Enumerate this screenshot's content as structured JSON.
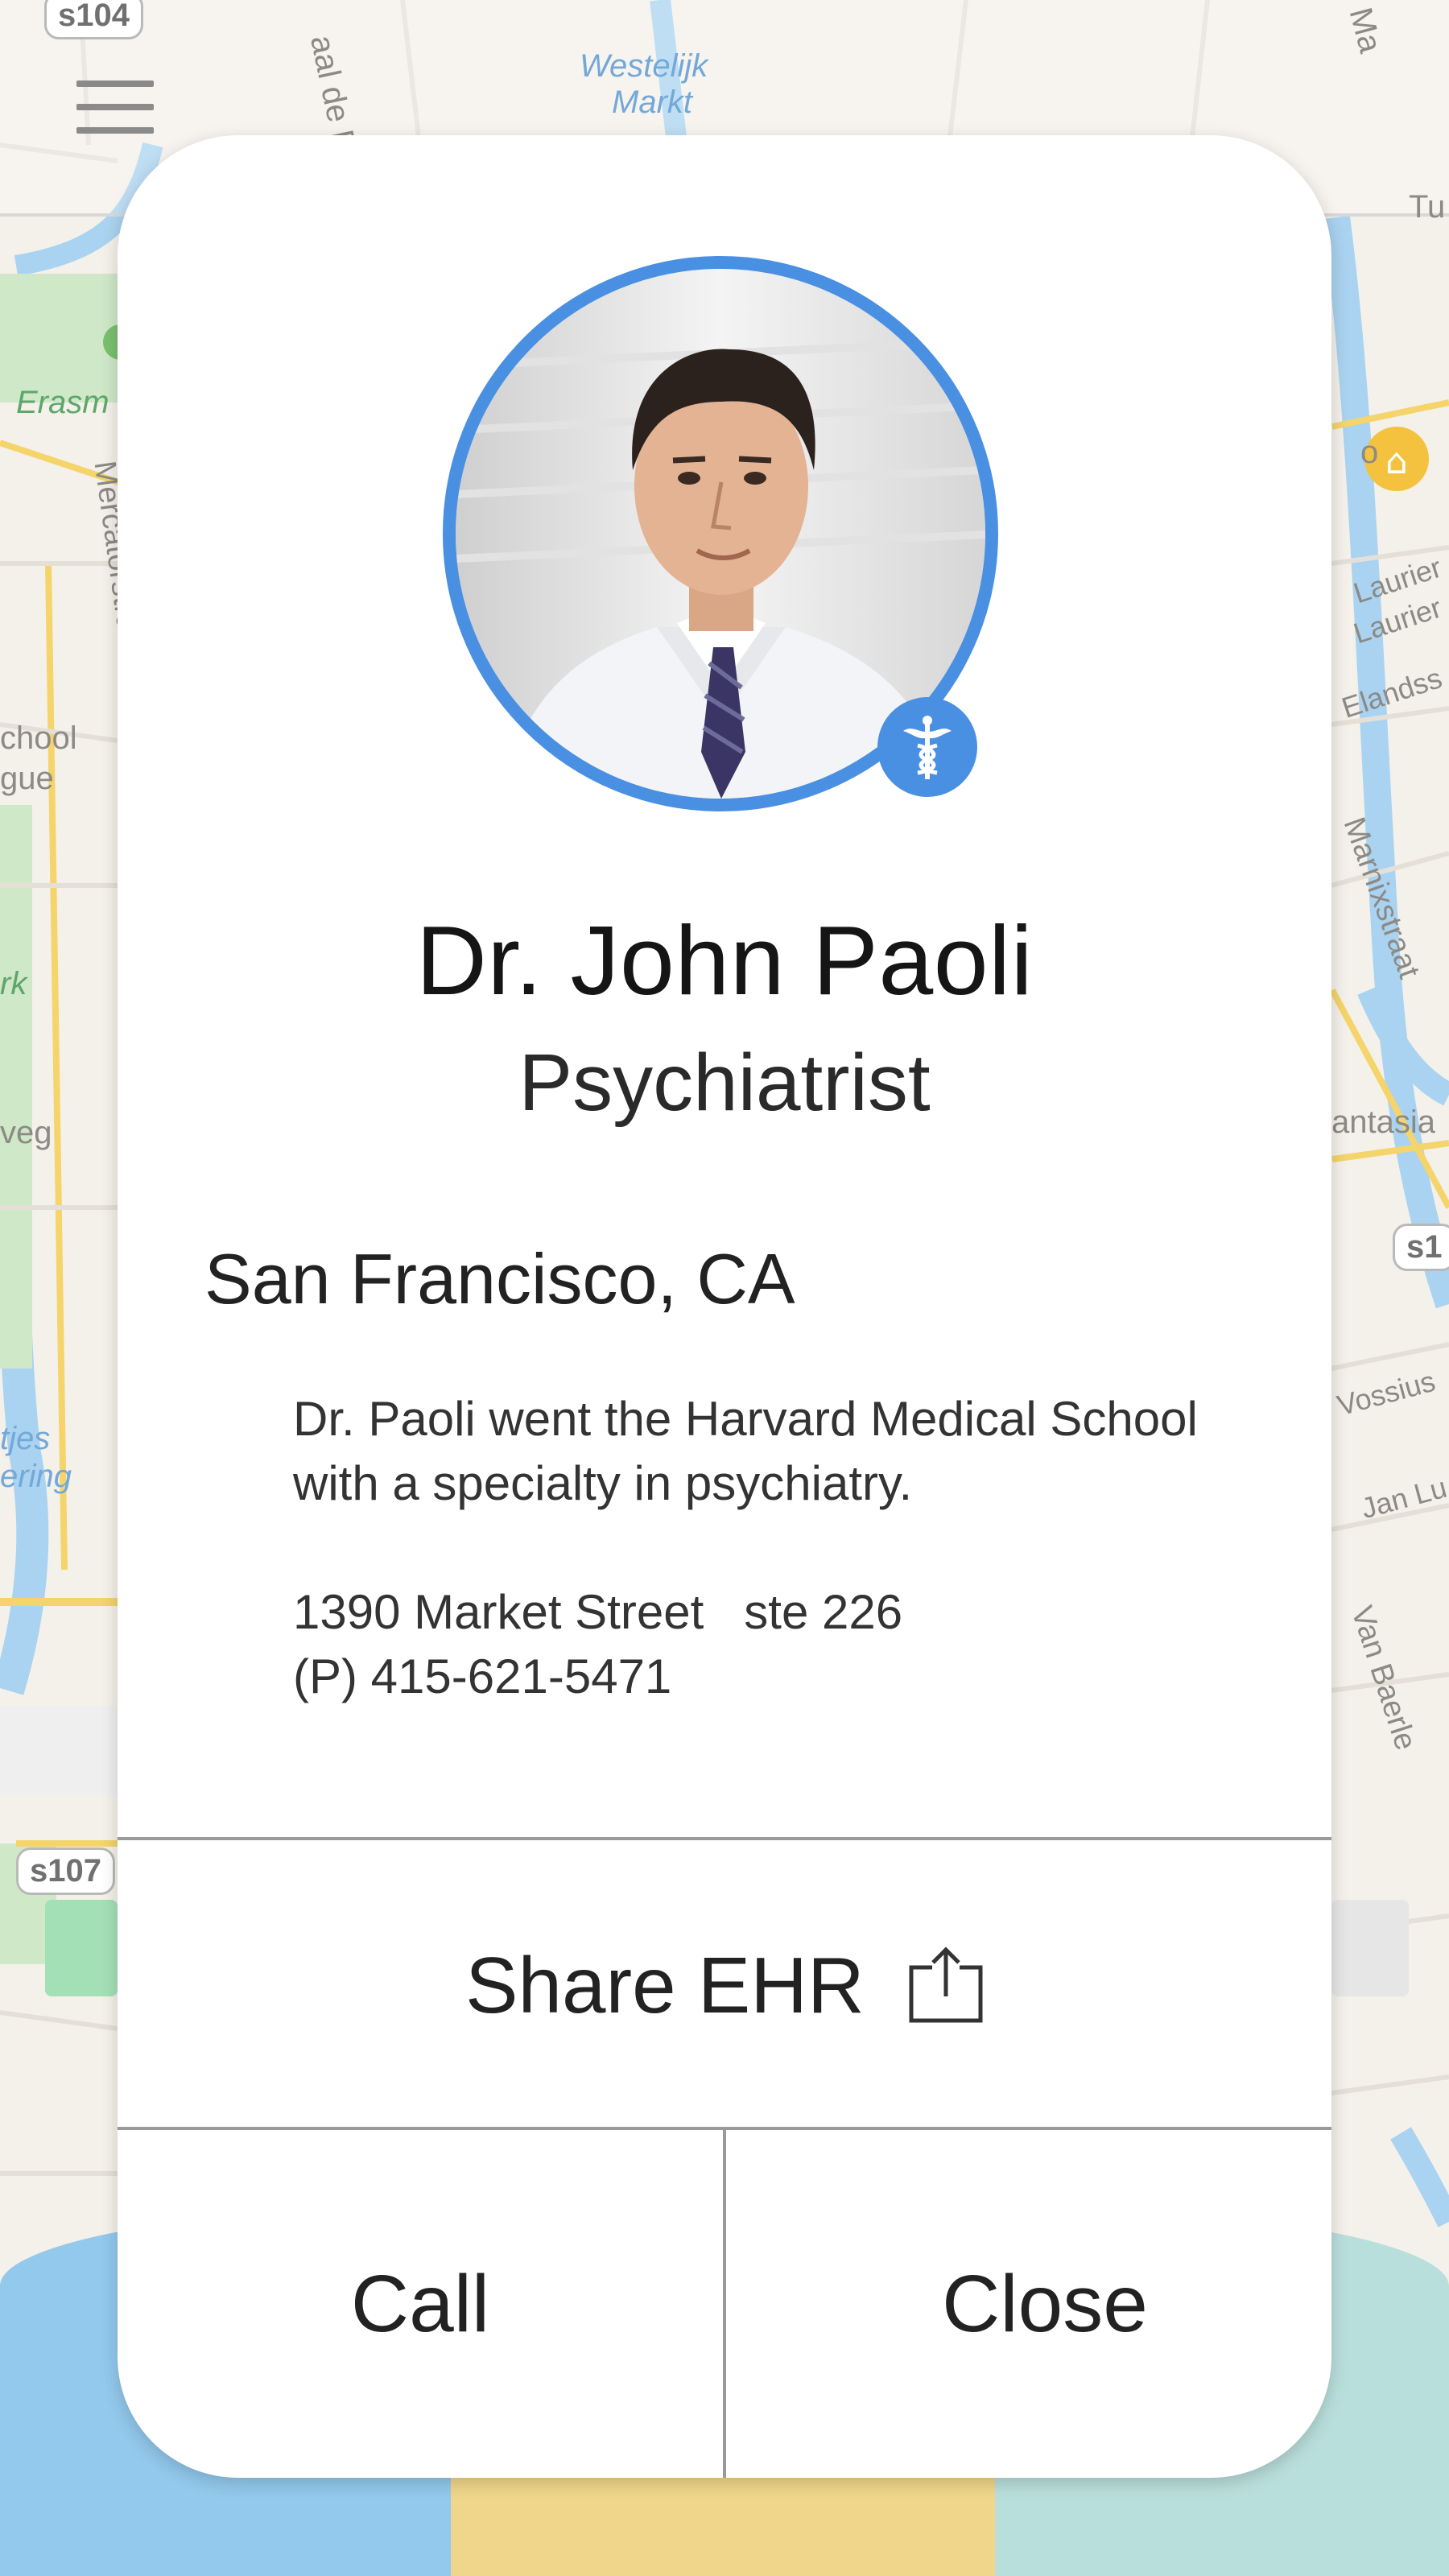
{
  "map": {
    "labels": {
      "westelijk": "Westelijk",
      "markt": "Markt",
      "erasm": "Erasm",
      "mercatorstraat": "Mercatorstraat",
      "chool": "chool",
      "gue": "gue",
      "rk": "rk",
      "veg": "veg",
      "tjes": "tjes",
      "ering": "ering",
      "lauriers1": "Laurier",
      "lauriers2": "Laurier",
      "elandss": "Elandss",
      "marnixstraat": "Marnixstraat",
      "antasia": "antasia",
      "vossius": "Vossius",
      "janlu": "Jan Lu",
      "vanbaerle": "Van Baerle",
      "aal_de_r": "aal de R",
      "ma": "Ma",
      "tu": "Tu",
      "o": "o"
    },
    "shields": {
      "s104": "s104",
      "s107": "s107",
      "s1": "s1"
    },
    "colors": {
      "water": "#a9d3f0",
      "park": "#cfe8c8",
      "band_left": "#93c9ed",
      "band_mid": "#f0d68a",
      "band_right": "#b9dfdc"
    }
  },
  "header": {
    "menu_icon": "hamburger-menu-icon"
  },
  "profile": {
    "name": "Dr. John Paoli",
    "specialty": "Psychiatrist",
    "location": "San Francisco, CA",
    "bio_line1": "Dr. Paoli went the Harvard Medical School",
    "bio_line2": "with a specialty in psychiatry.",
    "address_line1": "1390 Market Street   ste 226",
    "address_line2": "(P) 415-621-5471",
    "badge_icon": "caduceus-icon",
    "accent_color": "#4a90e2"
  },
  "actions": {
    "share_label": "Share EHR",
    "share_icon": "share-upload-icon",
    "call_label": "Call",
    "close_label": "Close"
  }
}
